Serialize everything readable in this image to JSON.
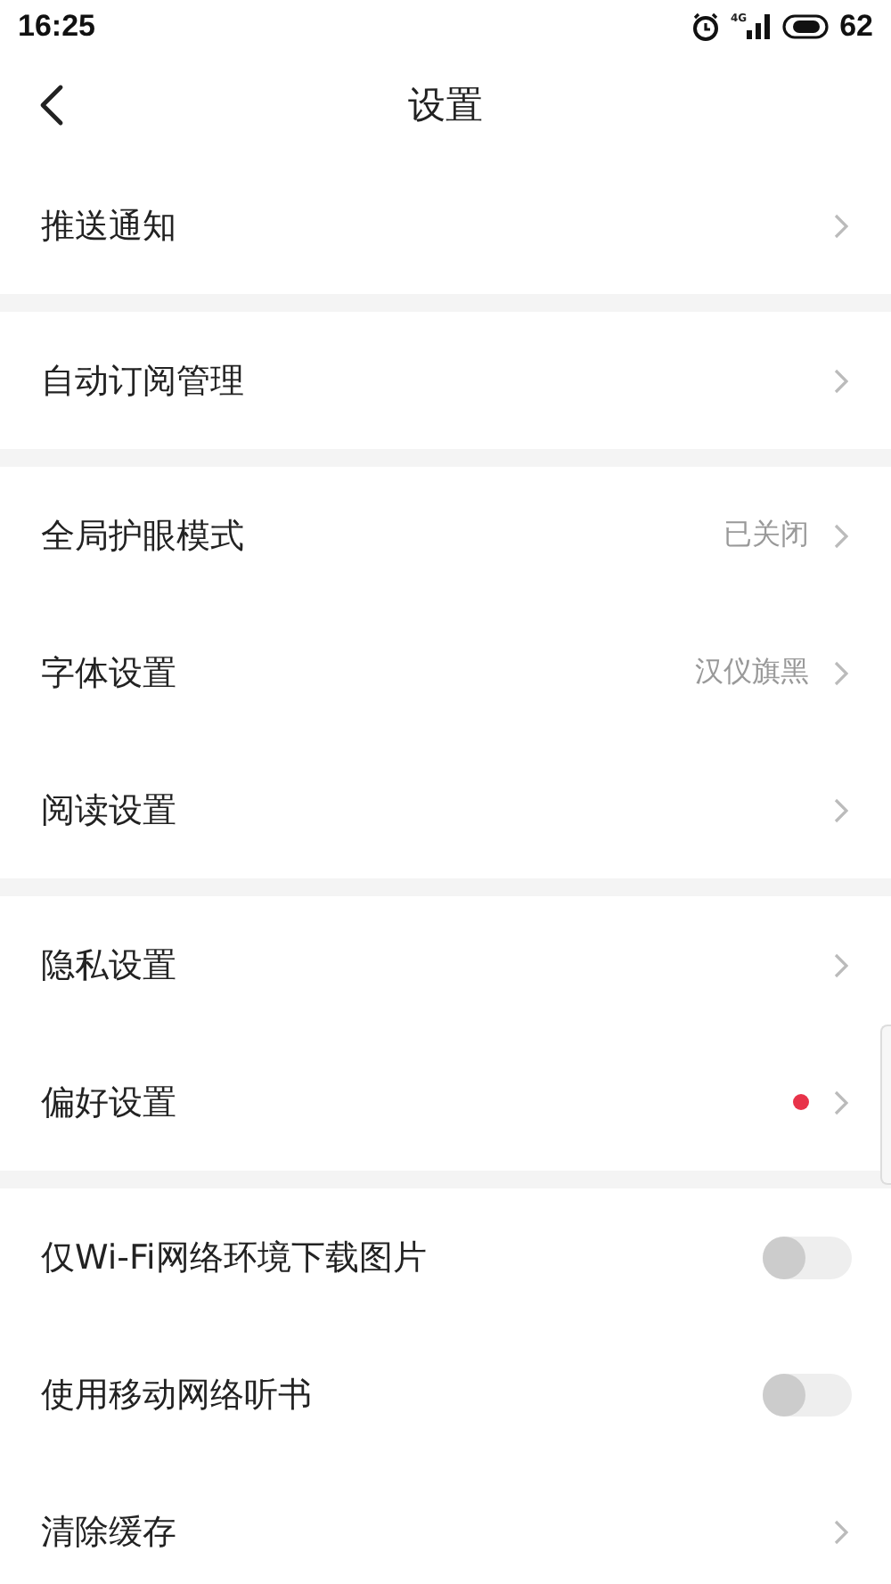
{
  "status_bar": {
    "time": "16:25",
    "network": "4G",
    "battery": "62"
  },
  "header": {
    "title": "设置"
  },
  "groups": [
    {
      "items": [
        {
          "kind": "link",
          "label": "推送通知"
        }
      ]
    },
    {
      "items": [
        {
          "kind": "link",
          "label": "自动订阅管理"
        }
      ]
    },
    {
      "items": [
        {
          "kind": "link",
          "label": "全局护眼模式",
          "value": "已关闭"
        },
        {
          "kind": "link",
          "label": "字体设置",
          "value": "汉仪旗黑"
        },
        {
          "kind": "link",
          "label": "阅读设置"
        }
      ]
    },
    {
      "items": [
        {
          "kind": "link",
          "label": "隐私设置",
          "badge": false
        },
        {
          "kind": "link",
          "label": "偏好设置",
          "badge": true
        }
      ]
    },
    {
      "items": [
        {
          "kind": "toggle",
          "label": "仅Wi-Fi网络环境下载图片",
          "on": false
        },
        {
          "kind": "toggle",
          "label": "使用移动网络听书",
          "on": false
        },
        {
          "kind": "link",
          "label": "清除缓存"
        }
      ]
    }
  ]
}
